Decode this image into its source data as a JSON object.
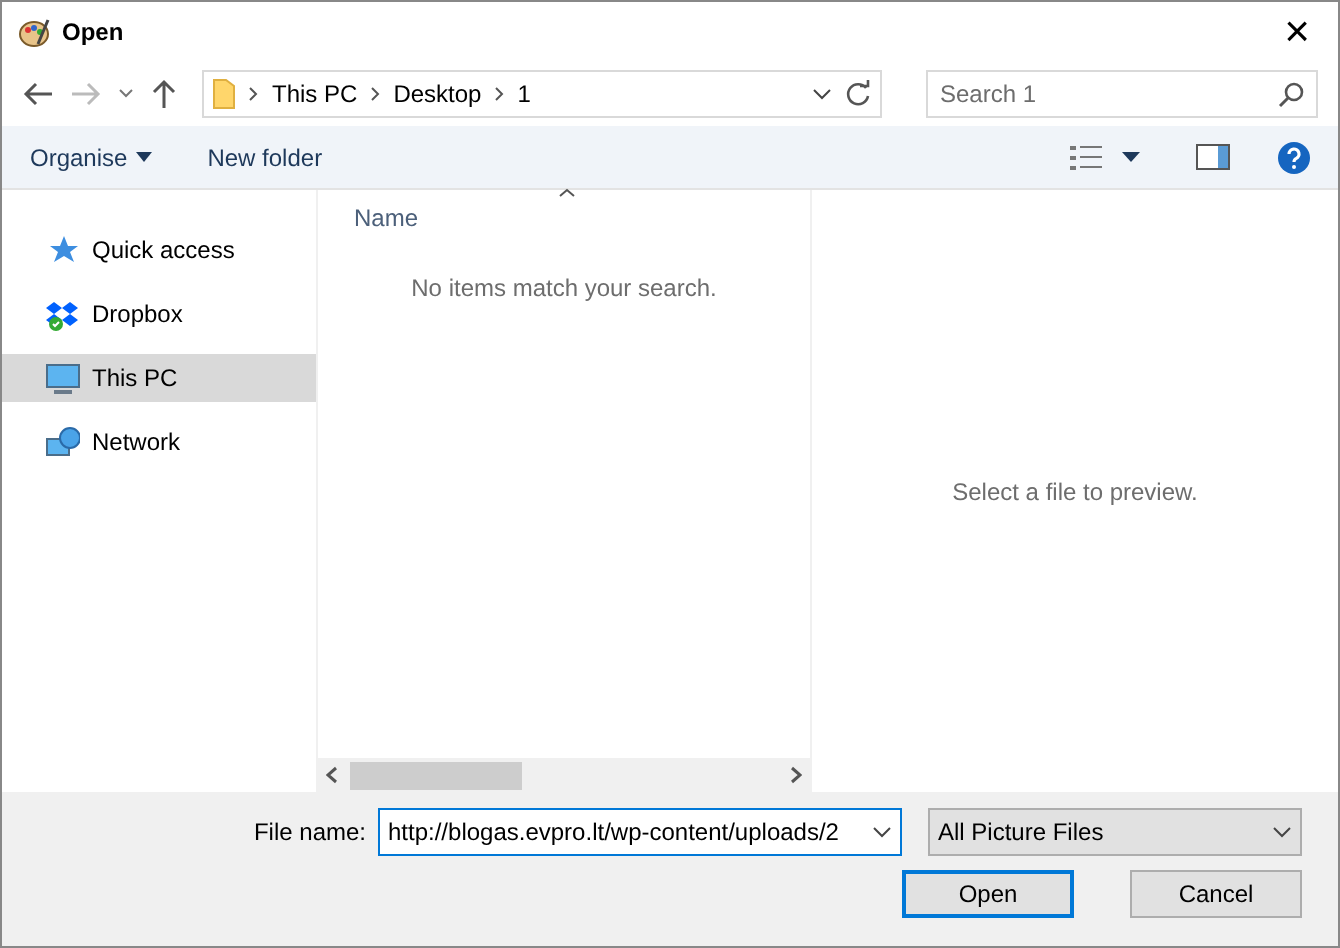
{
  "window": {
    "title": "Open",
    "close": "×"
  },
  "address": {
    "crumbs": [
      "This PC",
      "Desktop",
      "1"
    ]
  },
  "search": {
    "placeholder": "Search 1"
  },
  "toolbar": {
    "organise": "Organise",
    "new_folder": "New folder"
  },
  "sidebar": {
    "items": [
      {
        "label": "Quick access",
        "kind": "star",
        "selected": false
      },
      {
        "label": "Dropbox",
        "kind": "dropbox",
        "selected": false
      },
      {
        "label": "This PC",
        "kind": "pc",
        "selected": true
      },
      {
        "label": "Network",
        "kind": "network",
        "selected": false
      }
    ]
  },
  "file_list": {
    "column": "Name",
    "empty_message": "No items match your search."
  },
  "preview": {
    "message": "Select a file to preview."
  },
  "bottom": {
    "file_name_label": "File name:",
    "file_name_value": "http://blogas.evpro.lt/wp-content/uploads/2",
    "file_type": "All Picture Files",
    "buttons": [
      {
        "label": "Open",
        "kind": "primary"
      },
      {
        "label": "Cancel",
        "kind": "secondary"
      }
    ]
  }
}
